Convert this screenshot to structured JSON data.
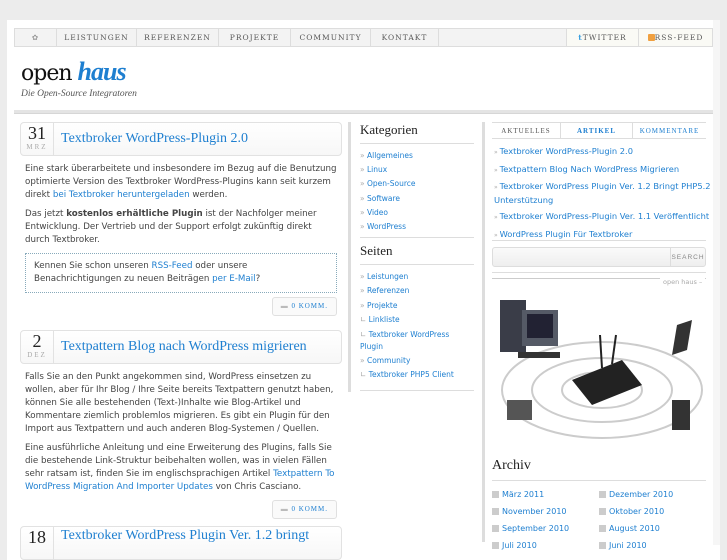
{
  "nav": {
    "items": [
      "LEISTUNGEN",
      "REFERENZEN",
      "PROJEKTE",
      "COMMUNITY",
      "KONTAKT"
    ],
    "twitter": "TWITTER",
    "rss": "RSS-FEED"
  },
  "logo": {
    "open": "open",
    "haus": "haus",
    "tagline": "Die Open-Source Integratoren"
  },
  "posts": [
    {
      "day": "31",
      "month": "MRZ",
      "title": "Textbroker WordPress-Plugin 2.0",
      "p1a": "Eine stark überarbeitete und insbesondere im Bezug auf die Benutzung optimierte Version des Textbroker WordPress-Plugins kann seit kurzem direkt ",
      "p1link": "bei Textbroker heruntergeladen",
      "p1b": " werden.",
      "p2a": "Das jetzt ",
      "p2bold": "kostenlos erhältliche Plugin",
      "p2b": " ist der Nachfolger meiner Entwicklung. Der Vertrieb und der Support erfolgt zukünftig direkt durch Textbroker.",
      "note_a": "Kennen Sie schon unseren ",
      "note_link1": "RSS-Feed",
      "note_b": " oder unsere Benachrichtigungen zu neuen Beiträgen ",
      "note_link2": "per E-Mail",
      "note_c": "?",
      "comments": "0 KOMM."
    },
    {
      "day": "2",
      "month": "DEZ",
      "title": "Textpattern Blog nach WordPress migrieren",
      "p1": "Falls Sie an den Punkt angekommen sind, WordPress einsetzen zu wollen, aber für Ihr Blog / Ihre Seite bereits Textpattern genutzt haben, können Sie alle bestehenden (Text-)Inhalte wie Blog-Artikel und Kommentare ziemlich problemlos migrieren. Es gibt ein Plugin für den Import aus Textpattern und auch anderen Blog-Systemen / Quellen.",
      "p2a": "Eine ausführliche Anleitung und eine Erweiterung des Plugins, falls Sie die bestehende Link-Struktur beibehalten wollen, was in vielen Fällen sehr ratsam ist, finden Sie im englischsprachigen Artikel ",
      "p2link": "Textpattern To WordPress Migration And Importer Updates",
      "p2b": " von Chris Casciano.",
      "comments": "0 KOMM."
    },
    {
      "day": "18",
      "title": "Textbroker WordPress Plugin Ver. 1.2 bringt"
    }
  ],
  "kategorien": {
    "title": "Kategorien",
    "items": [
      "Allgemeines",
      "Linux",
      "Open-Source",
      "Software",
      "Video",
      "WordPress"
    ]
  },
  "seiten": {
    "title": "Seiten",
    "items": [
      "Leistungen",
      "Referenzen",
      "Projekte",
      "Linkliste",
      "Textbroker WordPress Plugin",
      "Community",
      "Textbroker PHP5 Client"
    ]
  },
  "tabs": [
    "AKTUELLES",
    "ARTIKEL",
    "KOMMENTARE"
  ],
  "recent": [
    "Textbroker WordPress-Plugin 2.0",
    "Textpattern Blog Nach WordPress Migrieren",
    "Textbroker WordPress Plugin Ver. 1.2 Bringt PHP5.2 Unterstützung",
    "Textbroker WordPress-Plugin Ver. 1.1 Veröffentlicht",
    "WordPress Plugin Für Textbroker"
  ],
  "search": {
    "button": "SEARCH",
    "value": ""
  },
  "banner_label": "open haus –",
  "archiv": {
    "title": "Archiv",
    "items": [
      "März 2011",
      "Dezember 2010",
      "November 2010",
      "Oktober 2010",
      "September 2010",
      "August 2010",
      "Juli 2010",
      "Juni 2010"
    ]
  }
}
